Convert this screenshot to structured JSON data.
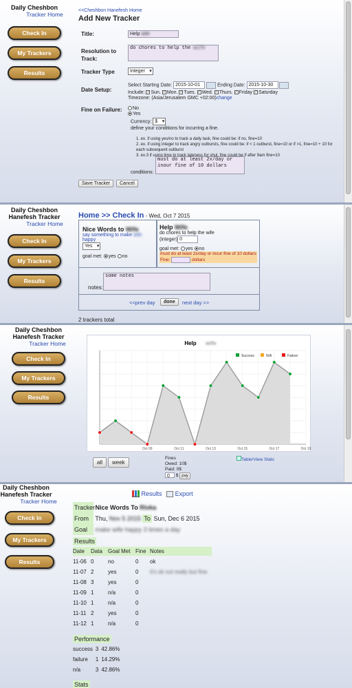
{
  "brand": {
    "line1": "Daily Cheshbon",
    "line1b": "Hanefesh Tracker",
    "line2": "Tracker Home"
  },
  "nav": {
    "checkin": "Check In",
    "mytrackers": "My Trackers",
    "results": "Results"
  },
  "colors": {
    "accent": "#2a4bb0",
    "nav_button": "#c69a4c",
    "success": "#11a036",
    "na": "#f5a623",
    "failure": "#e81c1c"
  },
  "add": {
    "back": "<<Cheshbon Hanefesh Home",
    "heading": "Add New Tracker",
    "title_label": "Title:",
    "title_value": "Help ",
    "resolution_label": "Resolution to Track:",
    "resolution_value": "do chores to help the ",
    "type_label": "Tracker Type",
    "type_value": "Integer",
    "date_label": "Date Setup:",
    "start_label": "Select Starting Date:",
    "start_value": "2015-10-01",
    "end_label": "Ending Date:",
    "end_value": "2015-10-30",
    "include_label": "Include:",
    "days": [
      "Sun.",
      "Mon.",
      "Tues.",
      "Wed.",
      "Thurs.",
      "Friday",
      "Saturday"
    ],
    "timezone": "Timezone: (Asia/Jerusalem GMC +02:00)",
    "tz_change": "change",
    "fine_label": "Fine on Failure:",
    "no": "No",
    "yes": "Yes",
    "currency_label": "Currency:",
    "currency_value": "$",
    "define": "define your conditions for incurring a fine.",
    "ex1": "1. ex. if using yes/no to track a daily task, fine could be: if no, fine=10",
    "ex2": "2. ex. if using integer to track angry outbursts, fine could be: if < 1 outburst, fine=10 or if >1, fine=10 + 10 for each subsequent outburst",
    "ex3": "3. ex.3 if using time to track lateness for shul, fine could be if after 9am fine=10",
    "conditions_value": "must do at least 2x/day or inour fine of 10 dollars",
    "conditions_label": "conditions:",
    "save": "Save Tracker",
    "cancel": "Cancel"
  },
  "checkin": {
    "crumb_home": "Home",
    "crumb_sep": " >> Check In",
    "date": " - Wed, Oct 7 2015",
    "t1_title": "Nice Words to ",
    "t1_desc": "say something to make ",
    "t1_desc2": " happy",
    "t1_value": "Yes",
    "goal_met": "goal met:",
    "yes": "yes",
    "no": "no",
    "t2_title": "Help ",
    "t2_desc": "do chores to help the wife",
    "t2_int": "(integer)",
    "t2_value": "0",
    "t2_fine_desc": "must do at least 2x/day or incur fine of 10 dollars",
    "fine": "Fine:",
    "dollars": "dollars",
    "notes_label": "notes:",
    "notes_value": "some notes",
    "prev": "<<prev day",
    "done": "done",
    "next": "next day >>",
    "total": "2 trackers total"
  },
  "chart_panel": {
    "all": "all",
    "week": "week",
    "fines": "Fines",
    "owed": "Owed: 10$",
    "paid": "Paid:  0$",
    "pay_value": "0",
    "pay": "pay",
    "table_link": "Table/View Stats"
  },
  "chart_data": {
    "type": "line",
    "title": "Help ",
    "x": [
      "Oct 06",
      "Oct 07",
      "Oct 08",
      "Oct 09",
      "Oct 10",
      "Oct 11",
      "Oct 12",
      "Oct 13",
      "Oct 14",
      "Oct 15",
      "Oct 16",
      "Oct 17",
      "Oct 18",
      "Oct 19"
    ],
    "values": [
      1,
      2,
      1,
      0,
      5,
      4,
      0,
      5,
      7,
      5,
      4,
      7,
      6,
      null
    ],
    "status": [
      "failure",
      "success",
      "failure",
      "failure",
      "success",
      "success",
      "failure",
      "success",
      "success",
      "success",
      "success",
      "success",
      "success",
      null
    ],
    "xticks": [
      "Oct 09",
      "Oct 11",
      "Oct 13",
      "Oct 15",
      "Oct 17",
      "Oct 19"
    ],
    "yticks": [
      0,
      1,
      2,
      3,
      4,
      5,
      6,
      7,
      8
    ],
    "ylim": [
      0,
      8
    ],
    "grid": true,
    "legend": [
      "Success",
      "N/A",
      "Failure"
    ],
    "legend_position": "top-right"
  },
  "results": {
    "results_link": "Results",
    "export_link": "Export",
    "tracker_label": "Tracker",
    "tracker_name": "Nice Words To ",
    "from_label": "From",
    "from_value": "Thu, ",
    "to_label": "To",
    "to_value": "Sun, Dec 6 2015",
    "goal_label": "Goal",
    "results_heading": "Results",
    "headers": [
      "Date",
      "Data",
      "Goal Met",
      "Fine",
      "Notes"
    ],
    "rows": [
      [
        "11-06",
        "0",
        "no",
        "0",
        "ok"
      ],
      [
        "11-07",
        "2",
        "yes",
        "0",
        ""
      ],
      [
        "11-08",
        "3",
        "yes",
        "0",
        ""
      ],
      [
        "11-09",
        "1",
        "n/a",
        "0",
        ""
      ],
      [
        "11-10",
        "1",
        "n/a",
        "0",
        ""
      ],
      [
        "11-11",
        "2",
        "yes",
        "0",
        ""
      ],
      [
        "11-12",
        "1",
        "n/a",
        "0",
        ""
      ]
    ],
    "perf_heading": "Performance",
    "perf": [
      [
        "success",
        "3",
        "42.86%"
      ],
      [
        "failure",
        "1",
        "14.29%"
      ],
      [
        "n/a",
        "3",
        "42.86%"
      ]
    ],
    "stats_heading": "Stats"
  }
}
